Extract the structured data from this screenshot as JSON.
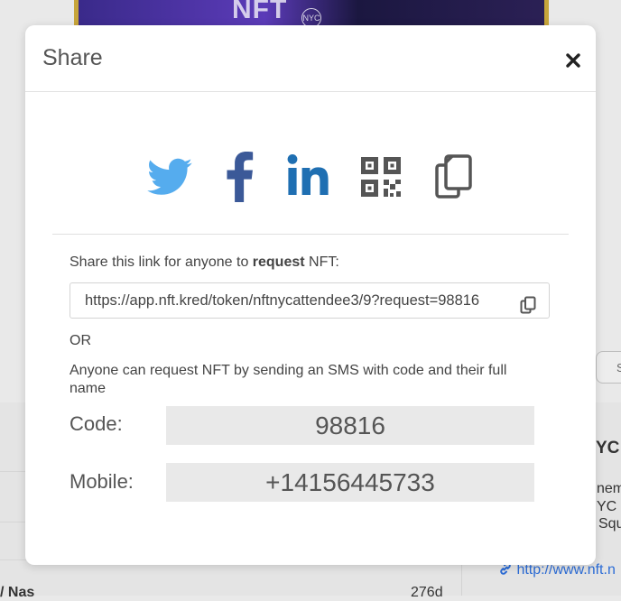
{
  "background": {
    "banner_text": "NFT",
    "banner_badge": "NYC",
    "right_snippets": [
      "YC",
      "nem",
      "YC e",
      "Squ"
    ],
    "right_link": "http://www.nft.n",
    "bottom_left_text": "/ Nas",
    "bottom_right_text": "276d",
    "side_button_text": "S"
  },
  "modal": {
    "title": "Share",
    "close_icon": "close-icon",
    "share_icons": [
      "twitter-icon",
      "facebook-icon",
      "linkedin-icon",
      "qr-code-icon",
      "copy-icon"
    ],
    "link_intro_prefix": "Share this link for anyone to ",
    "link_intro_bold": "request",
    "link_intro_suffix": " NFT:",
    "link_value": "https://app.nft.kred/token/nftnycattendee3/9?request=98816",
    "or_text": "OR",
    "sms_text": "Anyone can request NFT by sending an SMS with code and their full name",
    "code_label": "Code:",
    "code_value": "98816",
    "mobile_label": "Mobile:",
    "mobile_value": "+14156445733"
  },
  "colors": {
    "twitter": "#55ACEE",
    "facebook": "#3B5998",
    "linkedin": "#1F6FB2",
    "dark_icon": "#555555"
  }
}
